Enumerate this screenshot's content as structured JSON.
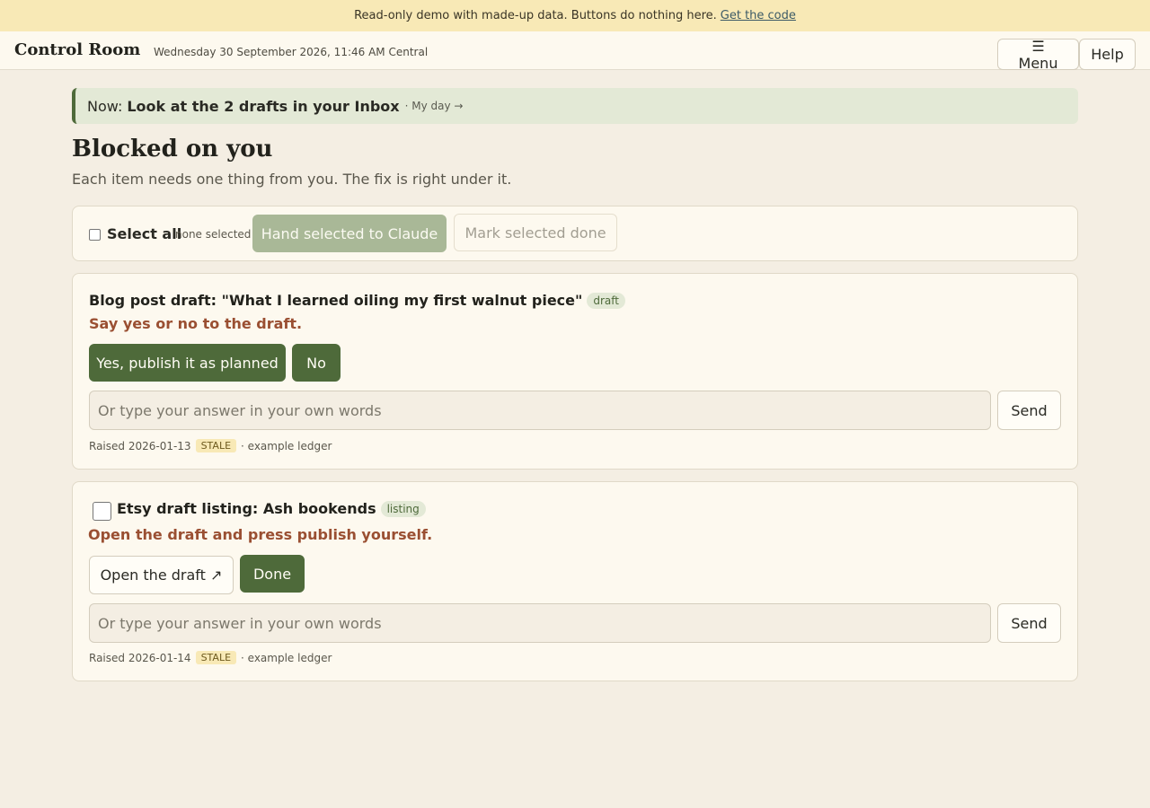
{
  "banner": {
    "text": "Read-only demo with made-up data. Buttons do nothing here.",
    "link": "Get the code"
  },
  "header": {
    "brand": "Control Room",
    "datetime": "Wednesday 30 September 2026, 11:46 AM Central",
    "menu_label": "☰ Menu",
    "help_label": "Help"
  },
  "now": {
    "label": "Now:",
    "task": "Look at the 2 drafts in your Inbox",
    "link": "· My day →"
  },
  "section": {
    "title": "Blocked on you",
    "subtitle": "Each item needs one thing from you. The fix is right under it."
  },
  "bulk": {
    "select_all": "Select all",
    "count": "none selected",
    "hand_label": "Hand selected to Claude",
    "done_label": "Mark selected done"
  },
  "items": [
    {
      "title": "Blog post draft: \"What I learned oiling my first walnut piece\"",
      "tag": "draft",
      "ask": "Say yes or no to the draft.",
      "actions": [
        "Yes, publish it as planned",
        "No"
      ],
      "placeholder": "Or type your answer in your own words",
      "send": "Send",
      "raised": "Raised 2026-01-13",
      "stale": "STALE",
      "source": "· example ledger"
    },
    {
      "title": "Etsy draft listing: Ash bookends",
      "tag": "listing",
      "ask": "Open the draft and press publish yourself.",
      "actions": [
        "Open the draft ↗",
        "Done"
      ],
      "placeholder": "Or type your answer in your own words",
      "send": "Send",
      "raised": "Raised 2026-01-14",
      "stale": "STALE",
      "source": "· example ledger"
    }
  ],
  "colors": {
    "accent": "#4e6a3a",
    "page_bg": "#f4eee3",
    "card_bg": "#fdf9ef",
    "banner_bg": "#f8e9b6",
    "ask_text": "#9a4f32"
  }
}
